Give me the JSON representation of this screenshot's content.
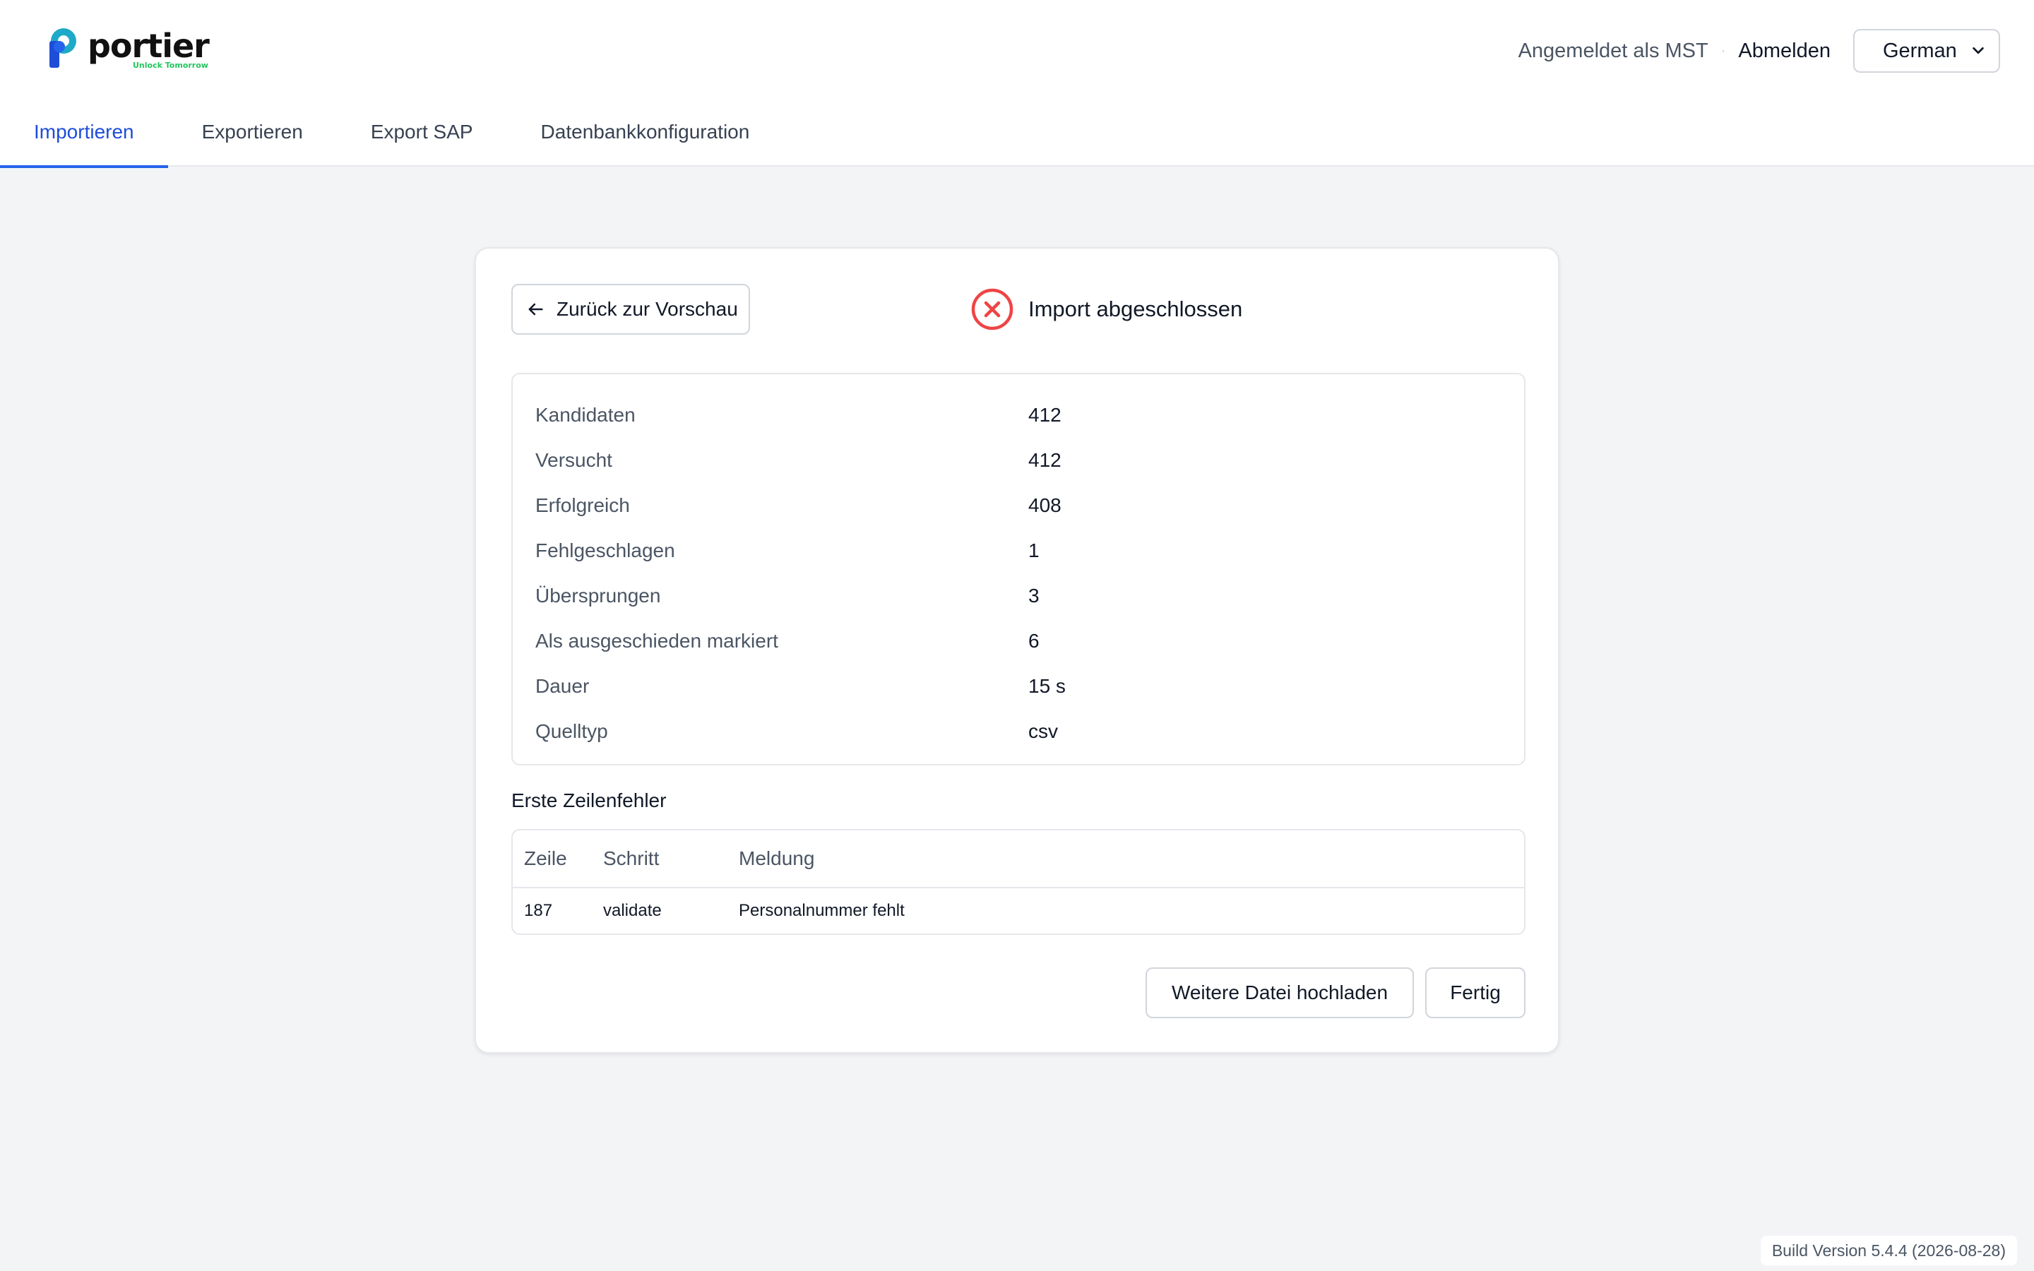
{
  "brand": {
    "name": "portier",
    "tagline": "Unlock Tomorrow"
  },
  "header": {
    "logged_in_as": "Angemeldet als MST",
    "separator": "·",
    "logout": "Abmelden",
    "language": "German"
  },
  "tabs": [
    {
      "label": "Importieren",
      "active": true
    },
    {
      "label": "Exportieren",
      "active": false
    },
    {
      "label": "Export SAP",
      "active": false
    },
    {
      "label": "Datenbankkonfiguration",
      "active": false
    }
  ],
  "card": {
    "back_label": "Zurück zur Vorschau",
    "status_title": "Import abgeschlossen",
    "stats": [
      {
        "label": "Kandidaten",
        "value": "412"
      },
      {
        "label": "Versucht",
        "value": "412"
      },
      {
        "label": "Erfolgreich",
        "value": "408"
      },
      {
        "label": "Fehlgeschlagen",
        "value": "1"
      },
      {
        "label": "Übersprungen",
        "value": "3"
      },
      {
        "label": "Als ausgeschieden markiert",
        "value": "6"
      },
      {
        "label": "Dauer",
        "value": "15 s"
      },
      {
        "label": "Quelltyp",
        "value": "csv"
      }
    ],
    "errors_title": "Erste Zeilenfehler",
    "errors_columns": [
      "Zeile",
      "Schritt",
      "Meldung"
    ],
    "errors_rows": [
      {
        "row": "187",
        "step": "validate",
        "message": "Personalnummer fehlt"
      }
    ],
    "upload_more": "Weitere Datei hochladen",
    "done": "Fertig"
  },
  "footer": {
    "build": "Build Version 5.4.4 (2026-08-28)"
  },
  "colors": {
    "accent": "#2563eb",
    "error": "#ef4444",
    "background": "#f3f4f6"
  }
}
